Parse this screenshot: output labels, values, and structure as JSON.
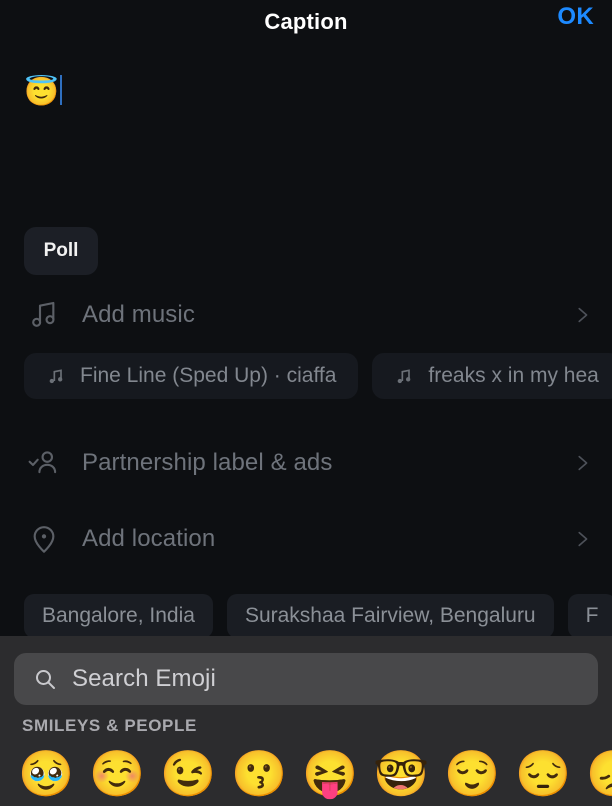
{
  "header": {
    "title": "Caption",
    "confirm_label": "OK",
    "confirm_color": "#1d8aff"
  },
  "caption": {
    "value": "😇",
    "emoji_name": "smiling-face-with-halo"
  },
  "poll": {
    "label": "Poll"
  },
  "options": [
    {
      "id": "add-music",
      "label": "Add music",
      "icon": "music-note-icon",
      "chevron": "chevron-right-icon"
    },
    {
      "id": "partnership",
      "label": "Partnership label & ads",
      "icon": "person-check-icon",
      "chevron": "chevron-right-icon"
    },
    {
      "id": "add-location",
      "label": "Add location",
      "icon": "location-pin-icon",
      "chevron": "chevron-right-icon"
    }
  ],
  "music_suggestions": [
    {
      "label": "Fine Line (Sped Up) · ciaffa",
      "icon": "music-note-icon"
    },
    {
      "label": "freaks x in my hea",
      "icon": "music-note-icon"
    }
  ],
  "location_suggestions": [
    {
      "label": "Bangalore, India"
    },
    {
      "label": "Surakshaa Fairview, Bengaluru"
    },
    {
      "label": "F"
    }
  ],
  "keyboard": {
    "search_placeholder": "Search Emoji",
    "search_icon": "search-icon",
    "category_header": "SMILEYS & PEOPLE",
    "panel_color": "#2c2c2e",
    "search_field_color": "#48484a",
    "emojis": [
      {
        "glyph": "🥹",
        "name": "face-holding-back-tears"
      },
      {
        "glyph": "☺️",
        "name": "smiling-face"
      },
      {
        "glyph": "😉",
        "name": "winking-face"
      },
      {
        "glyph": "😗",
        "name": "kissing-face"
      },
      {
        "glyph": "😝",
        "name": "squinting-face-with-tongue"
      },
      {
        "glyph": "🤓",
        "name": "nerd-face"
      },
      {
        "glyph": "😌",
        "name": "relieved-face"
      },
      {
        "glyph": "😔",
        "name": "pensive-face"
      },
      {
        "glyph": "😞",
        "name": "disappointed-face"
      }
    ]
  }
}
